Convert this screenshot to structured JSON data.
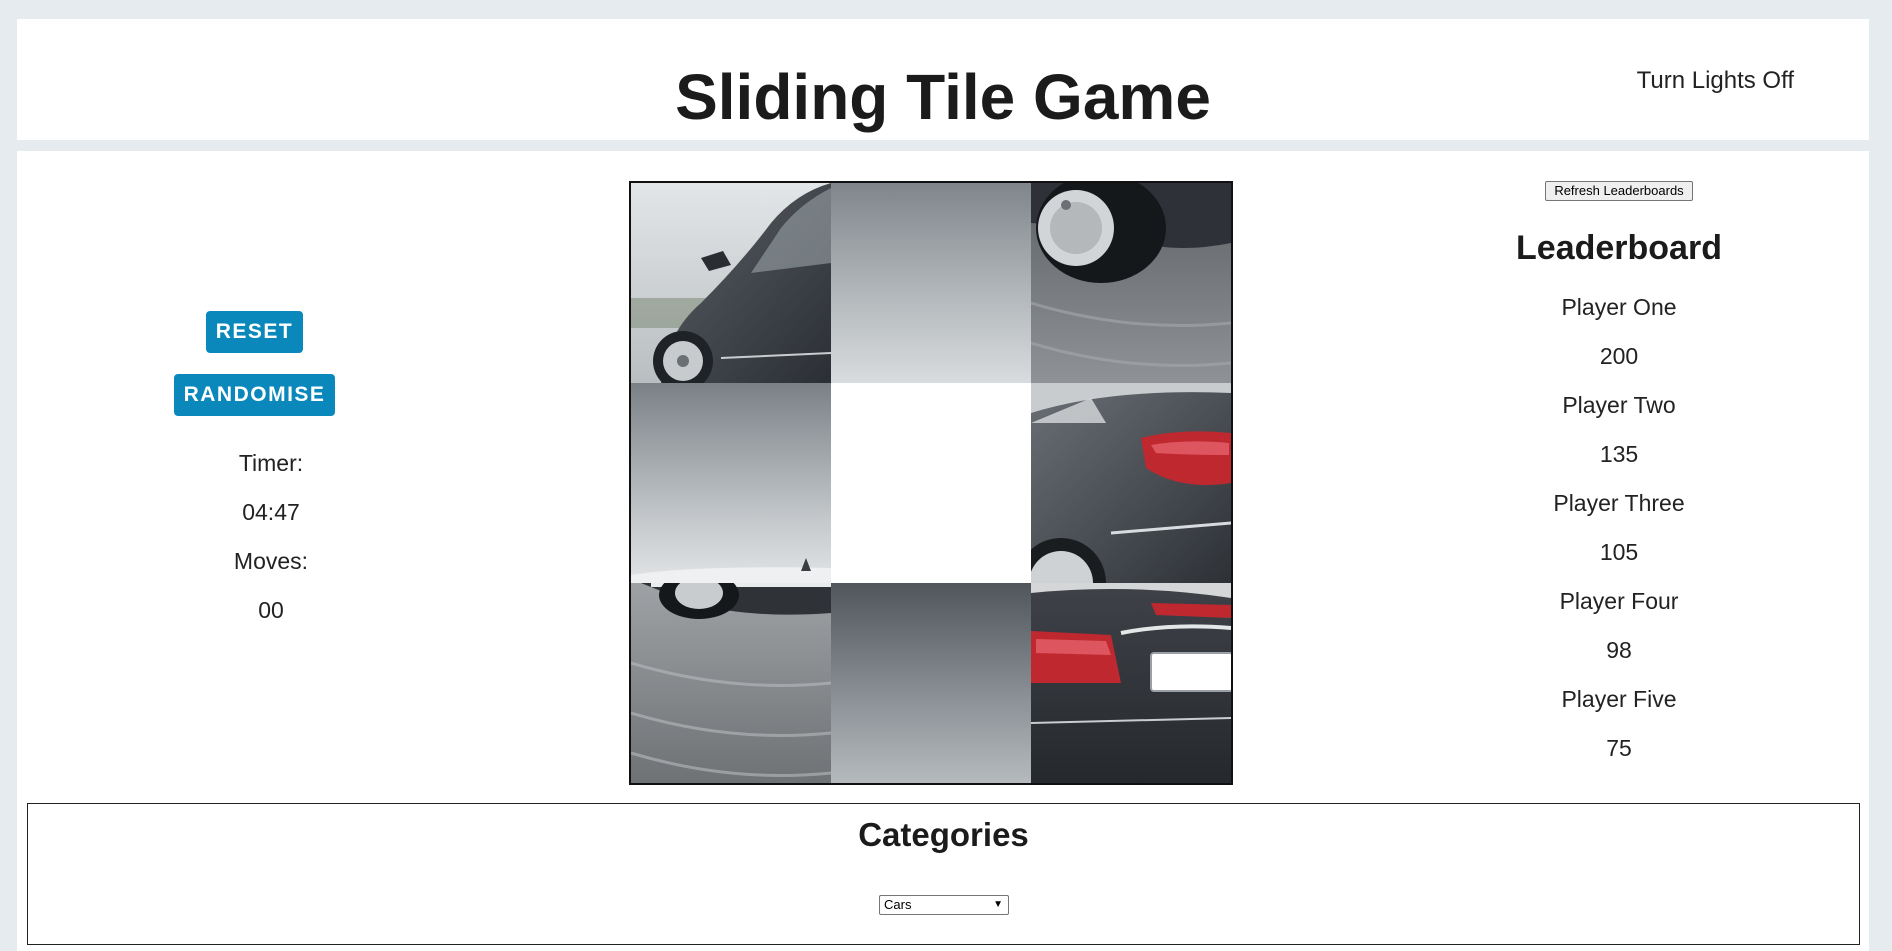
{
  "header": {
    "title": "Sliding Tile Game",
    "lights_toggle_label": "Turn Lights Off"
  },
  "controls": {
    "reset_label": "RESET",
    "randomise_label": "RANDOMISE",
    "timer_label": "Timer:",
    "timer_value": "04:47",
    "moves_label": "Moves:",
    "moves_value": "00"
  },
  "leaderboard": {
    "refresh_label": "Refresh Leaderboards",
    "title": "Leaderboard",
    "entries": [
      {
        "name": "Player One",
        "score": "200"
      },
      {
        "name": "Player Two",
        "score": "135"
      },
      {
        "name": "Player Three",
        "score": "105"
      },
      {
        "name": "Player Four",
        "score": "98"
      },
      {
        "name": "Player Five",
        "score": "75"
      }
    ]
  },
  "board": {
    "grid": "3x3",
    "tiles": [
      {
        "position": 1,
        "content": "car-front-door-mirror"
      },
      {
        "position": 2,
        "content": "grey-sky"
      },
      {
        "position": 3,
        "content": "car-rear-wheel-top"
      },
      {
        "position": 4,
        "content": "grey-sky-car-hood"
      },
      {
        "position": 5,
        "content": "empty"
      },
      {
        "position": 6,
        "content": "car-taillight-side"
      },
      {
        "position": 7,
        "content": "car-front-wheel-road"
      },
      {
        "position": 8,
        "content": "grey-sky-dark"
      },
      {
        "position": 9,
        "content": "car-rear-bumper-plate"
      }
    ]
  },
  "categories": {
    "title": "Categories",
    "selected": "Cars"
  },
  "colors": {
    "accent": "#0a88bb",
    "page_background": "#e6ebef",
    "panel_background": "#ffffff"
  }
}
